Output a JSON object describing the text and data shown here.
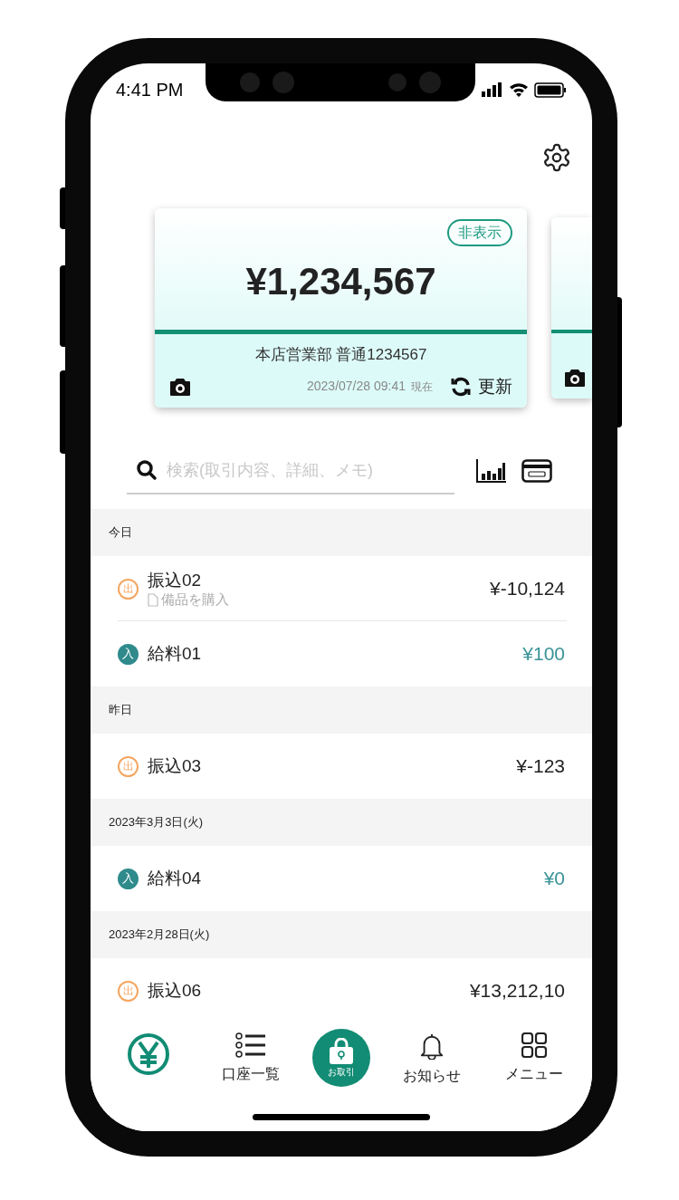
{
  "status_bar": {
    "time": "4:41 PM"
  },
  "account_card": {
    "hide_label": "非表示",
    "balance": "¥1,234,567",
    "account": "本店営業部 普通1234567",
    "timestamp": "2023/07/28  09:41",
    "timestamp_suffix": "現在",
    "refresh_label": "更新"
  },
  "search": {
    "placeholder": "検索(取引内容、詳細、メモ)"
  },
  "groups": [
    {
      "date": "今日",
      "transactions": [
        {
          "kind": "out",
          "badge": "出",
          "title": "振込02",
          "memo": "備品を購入",
          "amount": "¥-10,124"
        },
        {
          "kind": "in",
          "badge": "入",
          "title": "給料01",
          "amount": "¥100"
        }
      ]
    },
    {
      "date": "昨日",
      "transactions": [
        {
          "kind": "out",
          "badge": "出",
          "title": "振込03",
          "amount": "¥-123"
        }
      ]
    },
    {
      "date": "2023年3月3日(火)",
      "transactions": [
        {
          "kind": "in",
          "badge": "入",
          "title": "給料04",
          "amount": "¥0"
        }
      ]
    },
    {
      "date": "2023年2月28日(火)",
      "transactions": [
        {
          "kind": "out",
          "badge": "出",
          "title": "振込06",
          "amount": "¥13,212,10"
        }
      ]
    }
  ],
  "bottom_nav": [
    {
      "kind": "yen"
    },
    {
      "kind": "list",
      "label": "口座一覧"
    },
    {
      "kind": "center",
      "label": "お取引"
    },
    {
      "kind": "bell",
      "label": "お知らせ"
    },
    {
      "kind": "grid",
      "label": "メニュー"
    }
  ]
}
